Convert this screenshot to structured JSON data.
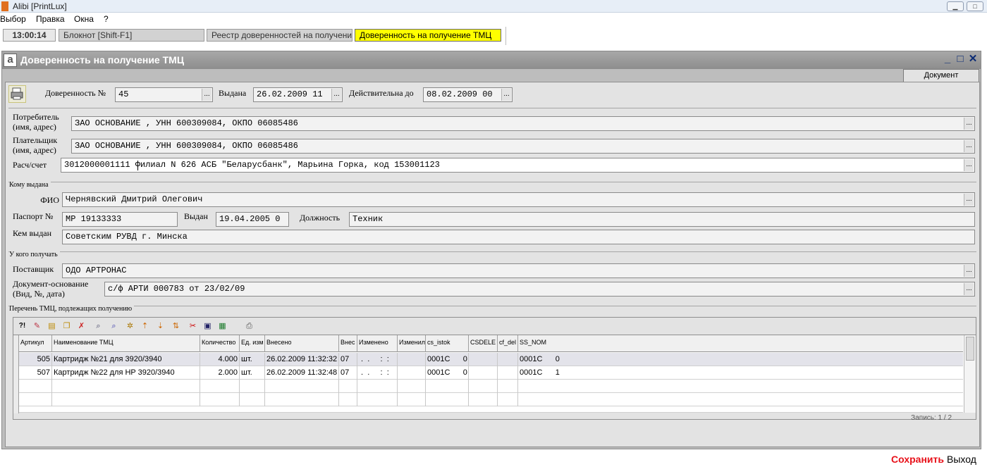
{
  "window": {
    "title": "Alibi [PrintLux]"
  },
  "menu": [
    "Выбор",
    "Правка",
    "Окна",
    "?"
  ],
  "tasks": {
    "clock": "13:00:14",
    "tabs": [
      "Блокнот  [Shift-F1]",
      "Реестр доверенностей на получение ТМЦ",
      "Доверенность на получение ТМЦ"
    ]
  },
  "form": {
    "title": "Доверенность на получение ТМЦ",
    "tab": "Документ",
    "header": {
      "number_label": "Доверенность №",
      "number": "45",
      "issued_label": "Выдана",
      "issued": "26.02.2009 11",
      "valid_label": "Действительна до",
      "valid": "08.02.2009 00"
    },
    "consumer": {
      "label": "Потребитель\n(имя, адрес)",
      "value": "ЗАО ОСНОВАНИЕ  , УНН 600309084, ОКПО 06085486"
    },
    "payer": {
      "label": "Плательщик\n(имя, адрес)",
      "value": "ЗАО ОСНОВАНИЕ  , УНН 600309084, ОКПО 06085486"
    },
    "account": {
      "label": "Расч/счет",
      "value": "3012000001111 Филиал N 626 АСБ \"Беларусбанк\", Марьина Горка, код 153001123"
    },
    "issued_to": {
      "group": "Кому выдана",
      "fio_label": "ФИО",
      "fio": "Чернявский Дмитрий Олегович",
      "passport_label": "Паспорт №",
      "passport": "MP 19133333",
      "passport_issued_label": "Выдан",
      "passport_issued": "19.04.2005 0",
      "position_label": "Должность",
      "position": "Техник",
      "issuer_label": "Кем выдан",
      "issuer": "Советским РУВД г. Минска"
    },
    "from": {
      "group": "У кого получать",
      "supplier_label": "Поставщик",
      "supplier": "ОДО АРТРОНАС",
      "basis_label": "Документ-основание\n(Вид, №, дата)",
      "basis": "с/ф АРТИ 000783 от 23/02/09"
    },
    "items": {
      "group": "Перечень ТМЦ, подлежащих получению",
      "columns": [
        "Артикул",
        "Наименование ТМЦ",
        "Количество",
        "Ед. изм",
        "Внесено",
        "Внес",
        "Изменено",
        "Изменил",
        "cs_istok",
        "CSDELE",
        "cf_del",
        "SS_NOM"
      ],
      "rows": [
        [
          "505",
          "Картридж №21 для 3920/3940",
          "4.000",
          "шт.",
          "26.02.2009 11:32:32",
          "07",
          " .  .     :  :",
          "",
          "0001С      0",
          "",
          "",
          "0001С      0"
        ],
        [
          "507",
          "Картридж №22 для HP 3920/3940",
          "2.000",
          "шт.",
          "26.02.2009 11:32:48",
          "07",
          " .  .     :  :",
          "",
          "0001С      0",
          "",
          "",
          "0001С      1"
        ]
      ],
      "status": "Запись: 1 / 2"
    }
  },
  "footer": {
    "save": "Сохранить",
    "exit": "Выход"
  },
  "colors": {
    "active_task": "#ffff00",
    "save": "#e8111a",
    "title_bar": "#8d8d8d"
  }
}
